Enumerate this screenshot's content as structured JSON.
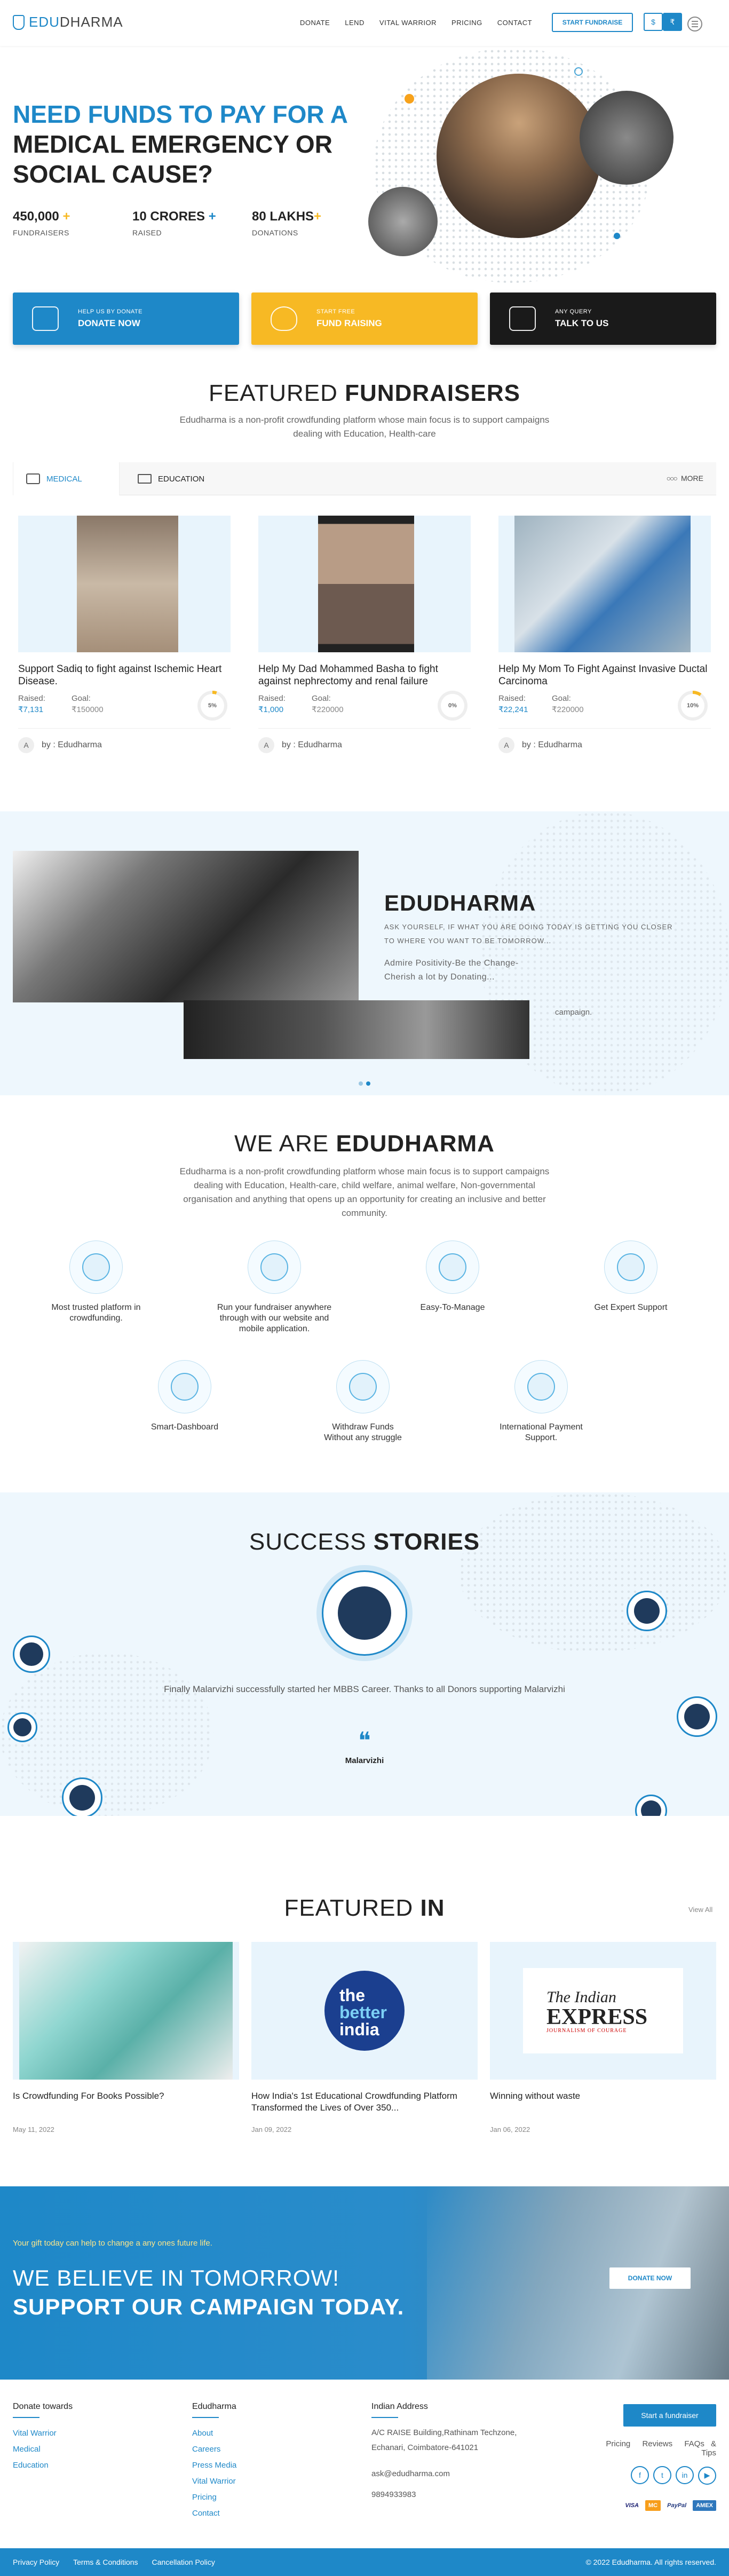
{
  "header": {
    "logo_prefix": "EDU",
    "logo_suffix": "DHARMA",
    "nav": [
      "DONATE",
      "LEND",
      "VITAL WARRIOR",
      "PRICING",
      "CONTACT"
    ],
    "start_fundraise": "START FUNDRAISE",
    "currency_usd": "$",
    "currency_inr": "₹"
  },
  "hero": {
    "title_line1": "NEED FUNDS TO PAY FOR A",
    "title_line2": "MEDICAL EMERGENCY OR",
    "title_line3": "SOCIAL CAUSE?",
    "stats": [
      {
        "num": "450,000",
        "label": "FUNDRAISERS"
      },
      {
        "num": "10 CRORES",
        "label": "RAISED"
      },
      {
        "num": "80 LAKHS",
        "label": "DONATIONS"
      }
    ]
  },
  "actions": [
    {
      "small": "HELP US BY DONATE",
      "big": "DONATE NOW",
      "color": "#1e88c8"
    },
    {
      "small": "START FREE",
      "big": "FUND RAISING",
      "color": "#f7b924"
    },
    {
      "small": "ANY QUERY",
      "big": "TALK TO US",
      "color": "#1a1a1a"
    }
  ],
  "featured": {
    "title_light": "FEATURED ",
    "title_bold": "FUNDRAISERS",
    "subtitle": "Edudharma is a non-profit crowdfunding platform whose main focus is to support campaigns dealing with Education, Health-care",
    "tabs": [
      "MEDICAL",
      "EDUCATION"
    ],
    "more": "MORE",
    "cards": [
      {
        "title": "Support Sadiq to fight against Ischemic Heart Disease.",
        "raised_label": "Raised:",
        "raised": "₹7,131",
        "goal_label": "Goal:",
        "goal": "₹150000",
        "percent": "5%",
        "by": "by : Edudharma",
        "initial": "A"
      },
      {
        "title": "Help My Dad Mohammed Basha to fight against nephrectomy and renal failure",
        "raised_label": "Raised:",
        "raised": "₹1,000",
        "goal_label": "Goal:",
        "goal": "₹220000",
        "percent": "0%",
        "by": "by : Edudharma",
        "initial": "A"
      },
      {
        "title": "Help My Mom To Fight Against Invasive Ductal Carcinoma",
        "raised_label": "Raised:",
        "raised": "₹22,241",
        "goal_label": "Goal:",
        "goal": "₹220000",
        "percent": "10%",
        "by": "by : Edudharma",
        "initial": "A"
      }
    ]
  },
  "carousel": {
    "title": "EDUDHARMA",
    "text1": "ASK YOURSELF, IF WHAT YOU ARE DOING TODAY IS GETTING YOU CLOSER TO WHERE YOU WANT TO BE TOMORROW...",
    "text2": "Admire Positivity-Be the Change-Cherish a lot by Donating...",
    "text3": "campaign."
  },
  "about": {
    "title_light": "WE ARE ",
    "title_bold": "EDUDHARMA",
    "subtitle": "Edudharma is a non-profit crowdfunding platform whose main focus is to support campaigns dealing with Education, Health-care, child welfare, animal welfare, Non-governmental organisation and anything that opens up an opportunity for creating an inclusive and better community.",
    "features": [
      "Most trusted platform in crowdfunding.",
      "Run your fundraiser anywhere through with our website and mobile application.",
      "Easy-To-Manage",
      "Get Expert Support",
      "Smart-Dashboard",
      "Withdraw Funds Without any struggle",
      "International Payment Support."
    ]
  },
  "stories": {
    "title_light": "SUCCESS ",
    "title_bold": "STORIES",
    "quote": "Finally Malarvizhi successfully started her MBBS Career. Thanks to all Donors supporting Malarvizhi",
    "quote_mark": "❝",
    "name": "Malarvizhi"
  },
  "featured_in": {
    "title_light": "FEATURED ",
    "title_bold": "IN",
    "view_all": "View All",
    "items": [
      {
        "title": "Is Crowdfunding For Books Possible?",
        "date": "May 11, 2022"
      },
      {
        "title": "How India's 1st Educational Crowdfunding Platform Transformed the Lives of Over 350...",
        "date": "Jan 09, 2022",
        "logo_l1": "the",
        "logo_l2": "better",
        "logo_l3": "india"
      },
      {
        "title": "Winning without waste",
        "date": "Jan 06, 2022",
        "logo_l1": "The Indian",
        "logo_l2": "EXPRESS",
        "logo_l3": "JOURNALISM OF COURAGE"
      }
    ]
  },
  "campaign": {
    "small": "Your gift today can help to change a any ones future life.",
    "line1": "WE BELIEVE IN TOMORROW!",
    "line2": "SUPPORT OUR CAMPAIGN TODAY.",
    "button": "DONATE NOW"
  },
  "footer": {
    "col1_title": "Donate towards",
    "col1_links": [
      "Vital Warrior",
      "Medical",
      "Education"
    ],
    "col2_title": "Edudharma",
    "col2_links": [
      "About",
      "Careers",
      "Press Media",
      "Vital Warrior",
      "Pricing",
      "Contact"
    ],
    "col3_title": "Indian Address",
    "address1": "A/C RAISE Building,Rathinam Techzone,",
    "address2": "Echanari, Coimbatore-641021",
    "email": "ask@edudharma.com",
    "phone": "9894933983",
    "start_button": "Start a fundraiser",
    "quick_links": [
      "Pricing",
      "Reviews",
      "FAQs & Tips"
    ],
    "social": [
      "f",
      "t",
      "in",
      "▶"
    ],
    "payments": [
      "VISA",
      "MC",
      "PayPal",
      "AMEX"
    ],
    "bottom_links": [
      "Privacy Policy",
      "Terms & Conditions",
      "Cancellation Policy"
    ],
    "copyright": "© 2022 Edudharma. All rights reserved."
  }
}
